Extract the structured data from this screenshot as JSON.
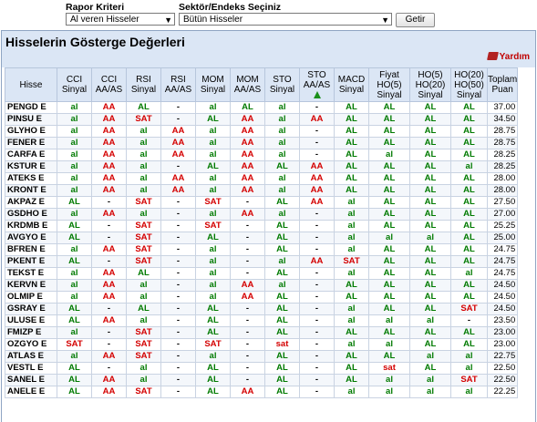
{
  "criteria": {
    "rapor_label": "Rapor Kriteri",
    "rapor_value": "Al veren Hisseler",
    "sektor_label": "Sektör/Endeks Seçiniz",
    "sektor_value": "Bütün Hisseler",
    "go_label": "Getir"
  },
  "panel": {
    "title": "Hisselerin Gösterge Değerleri",
    "help_label": "Yardım"
  },
  "headers": [
    {
      "l1": "Hisse",
      "l2": "",
      "l3": ""
    },
    {
      "l1": "CCI",
      "l2": "Sinyal",
      "l3": ""
    },
    {
      "l1": "CCI",
      "l2": "AA/AS",
      "l3": ""
    },
    {
      "l1": "RSI",
      "l2": "Sinyal",
      "l3": ""
    },
    {
      "l1": "RSI",
      "l2": "AA/AS",
      "l3": ""
    },
    {
      "l1": "MOM",
      "l2": "Sinyal",
      "l3": ""
    },
    {
      "l1": "MOM",
      "l2": "AA/AS",
      "l3": ""
    },
    {
      "l1": "STO",
      "l2": "Sinyal",
      "l3": ""
    },
    {
      "l1": "STO",
      "l2": "AA/AS",
      "l3": ""
    },
    {
      "l1": "MACD",
      "l2": "Sinyal",
      "l3": ""
    },
    {
      "l1": "Fiyat",
      "l2": "HO(5)",
      "l3": "Sinyal"
    },
    {
      "l1": "HO(5)",
      "l2": "HO(20)",
      "l3": "Sinyal"
    },
    {
      "l1": "HO(20)",
      "l2": "HO(50)",
      "l3": "Sinyal"
    },
    {
      "l1": "Toplam",
      "l2": "Puan",
      "l3": ""
    }
  ],
  "rows": [
    [
      "PENGD E",
      "al",
      "AA",
      "AL",
      "-",
      "al",
      "AL",
      "al",
      "-",
      "AL",
      "AL",
      "AL",
      "AL",
      "37.00"
    ],
    [
      "PINSU E",
      "al",
      "AA",
      "SAT",
      "-",
      "AL",
      "AA",
      "al",
      "AA",
      "AL",
      "AL",
      "AL",
      "AL",
      "34.50"
    ],
    [
      "GLYHO E",
      "al",
      "AA",
      "al",
      "AA",
      "al",
      "AA",
      "al",
      "-",
      "AL",
      "AL",
      "AL",
      "AL",
      "28.75"
    ],
    [
      "FENER E",
      "al",
      "AA",
      "al",
      "AA",
      "al",
      "AA",
      "al",
      "-",
      "AL",
      "AL",
      "AL",
      "AL",
      "28.75"
    ],
    [
      "CARFA E",
      "al",
      "AA",
      "al",
      "AA",
      "al",
      "AA",
      "al",
      "-",
      "AL",
      "al",
      "AL",
      "AL",
      "28.25"
    ],
    [
      "KSTUR E",
      "al",
      "AA",
      "al",
      "-",
      "AL",
      "AA",
      "AL",
      "AA",
      "AL",
      "AL",
      "AL",
      "al",
      "28.25"
    ],
    [
      "ATEKS E",
      "al",
      "AA",
      "al",
      "AA",
      "al",
      "AA",
      "al",
      "AA",
      "AL",
      "AL",
      "AL",
      "AL",
      "28.00"
    ],
    [
      "KRONT E",
      "al",
      "AA",
      "al",
      "AA",
      "al",
      "AA",
      "al",
      "AA",
      "AL",
      "AL",
      "AL",
      "AL",
      "28.00"
    ],
    [
      "AKPAZ E",
      "AL",
      "-",
      "SAT",
      "-",
      "SAT",
      "-",
      "AL",
      "AA",
      "al",
      "AL",
      "AL",
      "AL",
      "27.50"
    ],
    [
      "GSDHO E",
      "al",
      "AA",
      "al",
      "-",
      "al",
      "AA",
      "al",
      "-",
      "al",
      "AL",
      "AL",
      "AL",
      "27.00"
    ],
    [
      "KRDMB E",
      "AL",
      "-",
      "SAT",
      "-",
      "SAT",
      "-",
      "AL",
      "-",
      "al",
      "AL",
      "AL",
      "AL",
      "25.25"
    ],
    [
      "AVGYO E",
      "AL",
      "-",
      "SAT",
      "-",
      "AL",
      "-",
      "AL",
      "-",
      "al",
      "al",
      "al",
      "AL",
      "25.00"
    ],
    [
      "BFREN E",
      "al",
      "AA",
      "SAT",
      "-",
      "al",
      "-",
      "AL",
      "-",
      "al",
      "AL",
      "AL",
      "AL",
      "24.75"
    ],
    [
      "PKENT E",
      "AL",
      "-",
      "SAT",
      "-",
      "al",
      "-",
      "al",
      "AA",
      "SAT",
      "AL",
      "AL",
      "AL",
      "24.75"
    ],
    [
      "TEKST E",
      "al",
      "AA",
      "AL",
      "-",
      "al",
      "-",
      "AL",
      "-",
      "al",
      "AL",
      "AL",
      "al",
      "24.75"
    ],
    [
      "KERVN E",
      "al",
      "AA",
      "al",
      "-",
      "al",
      "AA",
      "al",
      "-",
      "AL",
      "AL",
      "AL",
      "AL",
      "24.50"
    ],
    [
      "OLMIP E",
      "al",
      "AA",
      "al",
      "-",
      "al",
      "AA",
      "AL",
      "-",
      "AL",
      "AL",
      "AL",
      "AL",
      "24.50"
    ],
    [
      "GSRAY E",
      "AL",
      "-",
      "AL",
      "-",
      "AL",
      "-",
      "AL",
      "-",
      "al",
      "AL",
      "AL",
      "SAT",
      "24.50"
    ],
    [
      "ULUSE E",
      "AL",
      "AA",
      "al",
      "-",
      "AL",
      "-",
      "AL",
      "-",
      "al",
      "al",
      "al",
      "-",
      "23.50"
    ],
    [
      "FMIZP E",
      "al",
      "-",
      "SAT",
      "-",
      "AL",
      "-",
      "AL",
      "-",
      "AL",
      "AL",
      "AL",
      "AL",
      "23.00"
    ],
    [
      "OZGYO E",
      "SAT",
      "-",
      "SAT",
      "-",
      "SAT",
      "-",
      "sat",
      "-",
      "al",
      "al",
      "AL",
      "AL",
      "23.00"
    ],
    [
      "ATLAS E",
      "al",
      "AA",
      "SAT",
      "-",
      "al",
      "-",
      "AL",
      "-",
      "AL",
      "AL",
      "al",
      "al",
      "22.75"
    ],
    [
      "VESTL E",
      "AL",
      "-",
      "al",
      "-",
      "AL",
      "-",
      "AL",
      "-",
      "AL",
      "sat",
      "AL",
      "al",
      "22.50"
    ],
    [
      "SANEL E",
      "AL",
      "AA",
      "al",
      "-",
      "AL",
      "-",
      "AL",
      "-",
      "AL",
      "al",
      "al",
      "SAT",
      "22.50"
    ],
    [
      "ANELE E",
      "AL",
      "AA",
      "SAT",
      "-",
      "AL",
      "AA",
      "AL",
      "-",
      "al",
      "al",
      "al",
      "al",
      "22.25"
    ]
  ],
  "colors": {
    "buy": "#007a00",
    "sell": "#d40000",
    "header_bg": "#dbe6f5"
  },
  "icons": {
    "help": "book-icon",
    "sto_trend": "triangle-up-icon"
  }
}
